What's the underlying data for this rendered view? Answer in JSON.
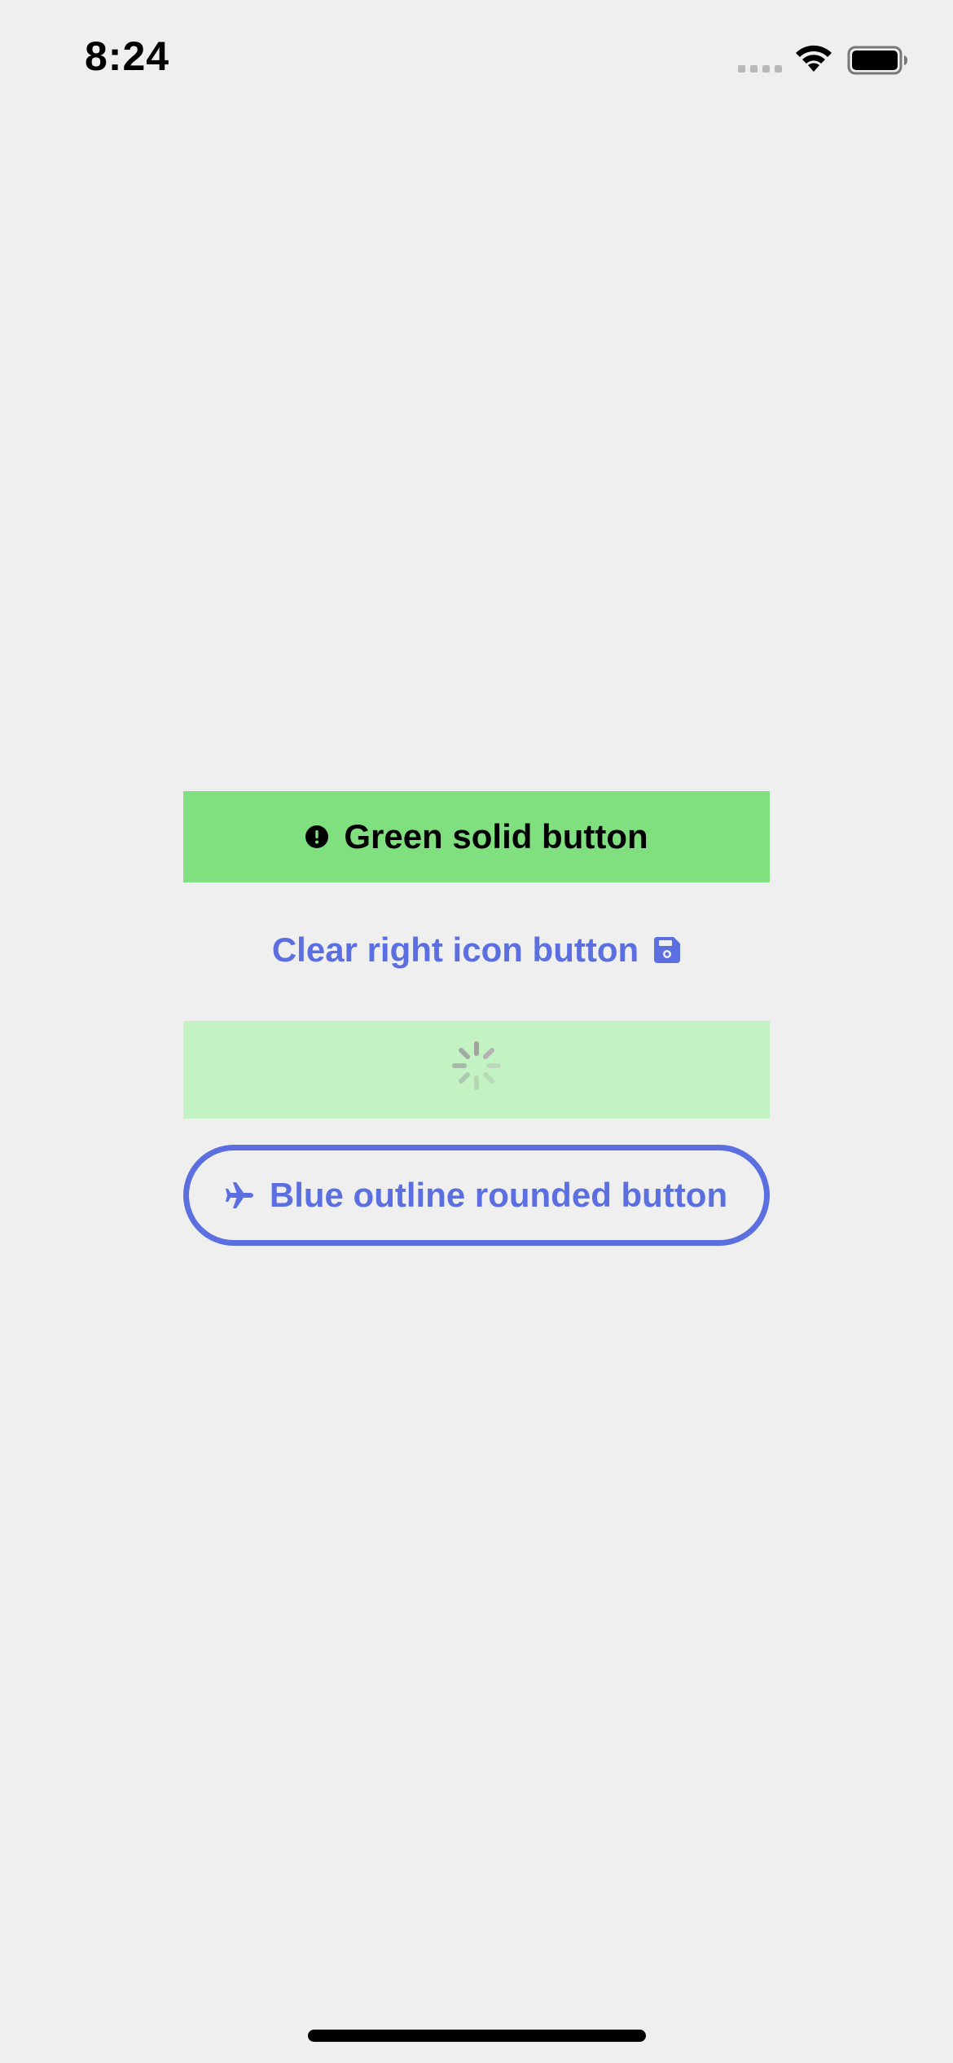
{
  "status_bar": {
    "time": "8:24"
  },
  "buttons": {
    "green_solid": {
      "label": "Green solid button",
      "icon": "exclamation-circle-icon",
      "color": "#80e080"
    },
    "clear_right_icon": {
      "label": "Clear right icon button",
      "icon": "save-icon",
      "color": "#5b6fe0"
    },
    "loading": {
      "icon": "spinner-icon",
      "color": "#c3f3c3"
    },
    "blue_outline_rounded": {
      "label": "Blue outline rounded button",
      "icon": "airplane-icon",
      "color": "#5b6fe0"
    }
  }
}
